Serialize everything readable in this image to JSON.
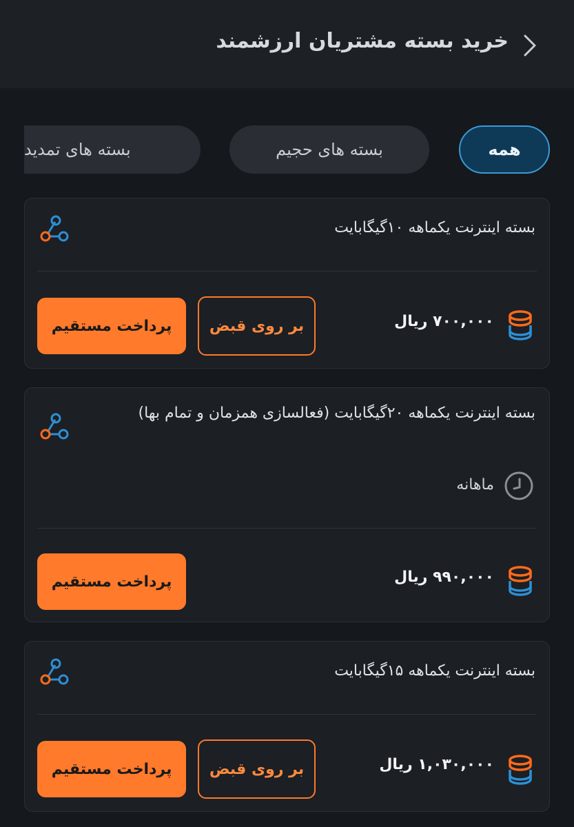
{
  "header": {
    "title": "خرید بسته مشتریان ارزشمند",
    "back_icon": "chevron-right-icon"
  },
  "filters": [
    {
      "label": "همه",
      "active": true
    },
    {
      "label": "بسته های حجیم",
      "active": false
    },
    {
      "label": "بسته های تمدید",
      "active": false
    }
  ],
  "packages": [
    {
      "title": "بسته اینترنت یکماهه ۱۰گیگابایت",
      "price": "۷۰۰,۰۰۰ ریال",
      "direct_pay_label": "پرداخت مستقیم",
      "bill_label": "بر روی قبض"
    },
    {
      "title": "بسته اینترنت یکماهه ۲۰گیگابایت (فعالسازی همزمان و تمام بها)",
      "period": "ماهانه",
      "price": "۹۹۰,۰۰۰ ریال",
      "direct_pay_label": "پرداخت مستقیم"
    },
    {
      "title": "بسته اینترنت یکماهه ۱۵گیگابایت",
      "price": "۱,۰۳۰,۰۰۰ ریال",
      "direct_pay_label": "پرداخت مستقیم",
      "bill_label": "بر روی قبض"
    }
  ],
  "colors": {
    "accent": "#ff7a2b",
    "active_chip": "#0f3a57",
    "active_chip_border": "#3a9bd8",
    "icon_blue": "#2d8fd5",
    "icon_orange": "#ff6a1a"
  }
}
